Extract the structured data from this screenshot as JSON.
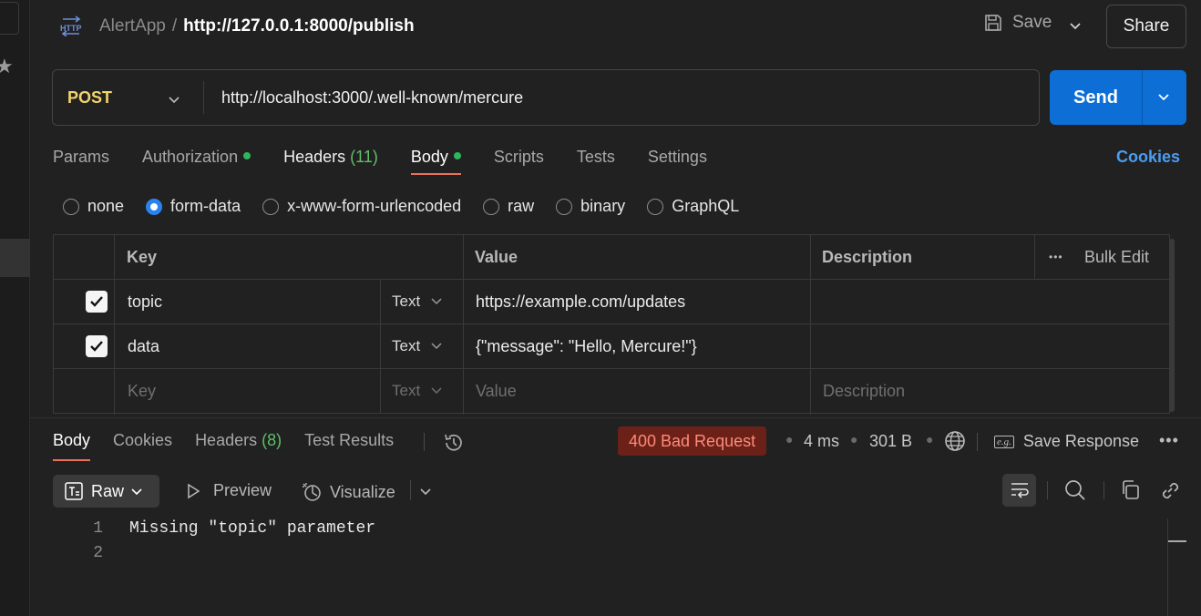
{
  "header": {
    "http_icon_text": "HTTP",
    "app_name": "AlertApp",
    "separator": "/",
    "request_title": "http://127.0.0.1:8000/publish",
    "save_label": "Save",
    "share_label": "Share"
  },
  "request": {
    "method": "POST",
    "url": "http://localhost:3000/.well-known/mercure",
    "send_label": "Send"
  },
  "request_tabs": {
    "params": "Params",
    "authorization": "Authorization",
    "headers": "Headers",
    "headers_count": "(11)",
    "body": "Body",
    "scripts": "Scripts",
    "tests": "Tests",
    "settings": "Settings",
    "cookies": "Cookies"
  },
  "body_types": {
    "none": "none",
    "form_data": "form-data",
    "urlencoded": "x-www-form-urlencoded",
    "raw": "raw",
    "binary": "binary",
    "graphql": "GraphQL",
    "selected": "form-data"
  },
  "form_table": {
    "columns": {
      "key": "Key",
      "value": "Value",
      "description": "Description",
      "bulk_edit": "Bulk Edit",
      "more": "•••"
    },
    "rows": [
      {
        "key": "topic",
        "type": "Text",
        "value": "https://example.com/updates",
        "description": "",
        "checked": true
      },
      {
        "key": "data",
        "type": "Text",
        "value": "{\"message\": \"Hello, Mercure!\"}",
        "description": "",
        "checked": true
      }
    ],
    "placeholder_row": {
      "key": "Key",
      "type": "Text",
      "value": "Value",
      "description": "Description"
    }
  },
  "response": {
    "tabs": {
      "body": "Body",
      "cookies": "Cookies",
      "headers": "Headers",
      "headers_count": "(8)",
      "test_results": "Test Results"
    },
    "status": "400 Bad Request",
    "time": "4 ms",
    "size": "301 B",
    "save_response": "Save Response",
    "eg_label": "e.g.",
    "more": "•••",
    "view": {
      "raw": "Raw",
      "preview": "Preview",
      "visualize": "Visualize"
    },
    "lines": [
      {
        "no": "1",
        "text": "Missing \"topic\" parameter"
      },
      {
        "no": "2",
        "text": ""
      }
    ]
  },
  "colors": {
    "accent_blue": "#0d6ed6",
    "method_yellow": "#f2d46a",
    "status_bg": "#6b2118",
    "status_fg": "#ff8a78",
    "active_tab_underline": "#e8715a",
    "dot_green": "#2fb55d"
  },
  "icons": [
    "http-icon",
    "save-icon",
    "chevron-down-icon",
    "history-icon",
    "globe-icon",
    "save-response-icon",
    "raw-icon",
    "preview-play-icon",
    "visualize-icon",
    "wrap-lines-icon",
    "search-icon",
    "copy-icon",
    "link-icon",
    "star-icon",
    "checkbox-checked-icon"
  ]
}
